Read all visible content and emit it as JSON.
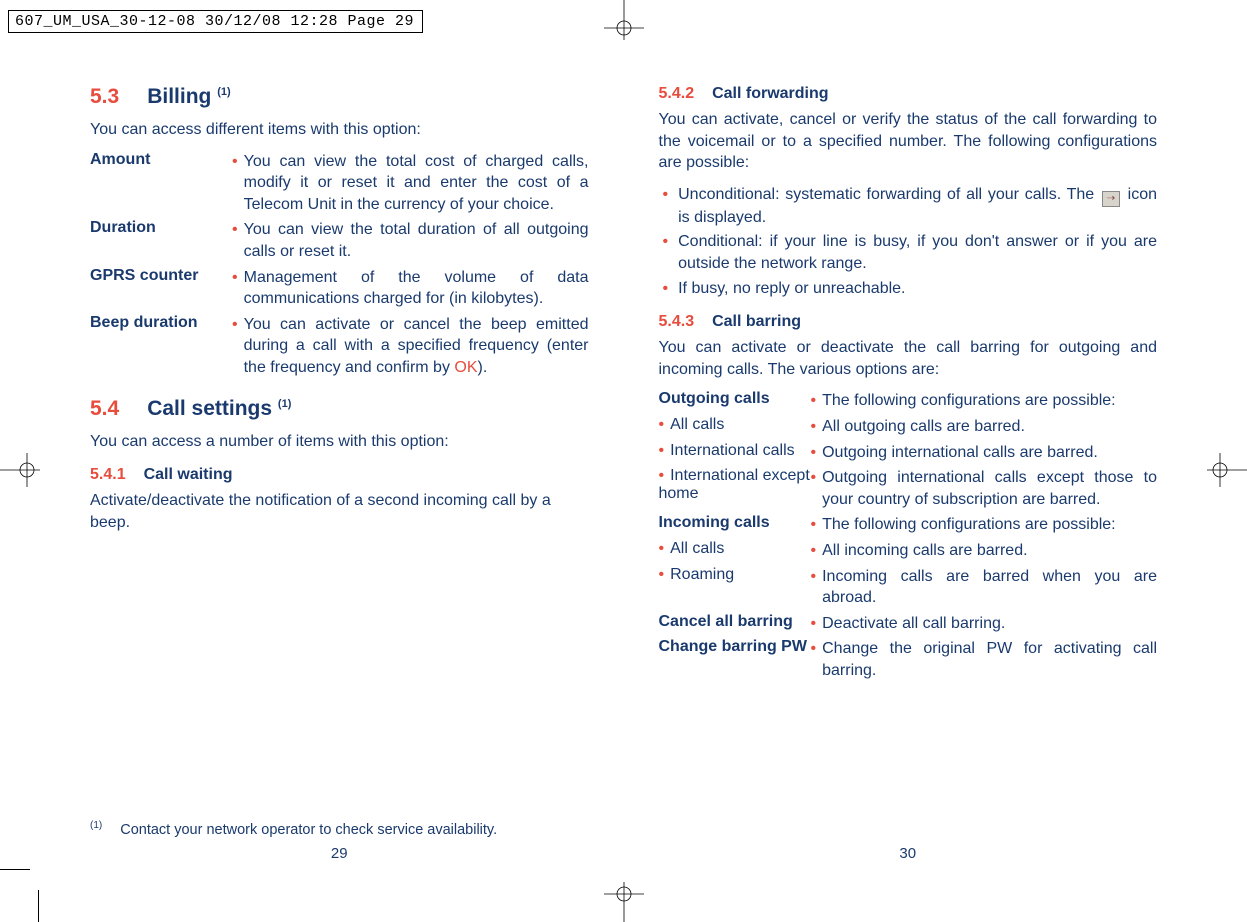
{
  "header_strip": "607_UM_USA_30-12-08  30/12/08  12:28  Page 29",
  "left": {
    "page_num": "29",
    "s53": {
      "num": "5.3",
      "title": "Billing",
      "sup": "(1)",
      "intro": "You can access different items with this option:",
      "rows": [
        {
          "label": "Amount",
          "text": "You can view the total cost of charged calls, modify it or reset it and enter the cost of a Telecom Unit in the currency of your choice."
        },
        {
          "label": "Duration",
          "text": "You can view the total duration of all outgoing calls or reset it."
        },
        {
          "label": "GPRS counter",
          "text": "Management of the volume of data communications charged for (in kilobytes)."
        },
        {
          "label": "Beep duration",
          "text_pre": "You can activate or cancel the beep emitted during a call with a specified frequency (enter the frequency and confirm by ",
          "ok": "OK",
          "text_post": ")."
        }
      ]
    },
    "s54": {
      "num": "5.4",
      "title": "Call settings",
      "sup": "(1)",
      "intro": "You can access a number of items with this option:"
    },
    "s541": {
      "num": "5.4.1",
      "title": "Call waiting",
      "text": "Activate/deactivate the notification of a second incoming call by a beep."
    },
    "footnote": {
      "sup": "(1)",
      "text": "Contact your network operator to check service availability."
    }
  },
  "right": {
    "page_num": "30",
    "s542": {
      "num": "5.4.2",
      "title": "Call forwarding",
      "intro": "You can activate, cancel or verify the status of the call forwarding to the voicemail or to a specified number. The following configurations are possible:",
      "bullets": [
        {
          "pre": "Unconditional: systematic forwarding of all your calls. The ",
          "post": " icon is displayed.",
          "has_icon": true
        },
        {
          "pre": "Conditional: if your line is busy, if you don't answer or if you are outside the network range.",
          "post": "",
          "has_icon": false
        },
        {
          "pre": "If busy, no reply or unreachable.",
          "post": "",
          "has_icon": false
        }
      ]
    },
    "s543": {
      "num": "5.4.3",
      "title": "Call barring",
      "intro": "You can activate or deactivate the call barring for outgoing and incoming calls. The various options are:",
      "rows": [
        {
          "label": "Outgoing calls",
          "bold": true,
          "sub": false,
          "text": "The following configurations are possible:"
        },
        {
          "label": "All calls",
          "bold": false,
          "sub": true,
          "text": "All outgoing calls are barred."
        },
        {
          "label": "International calls",
          "bold": false,
          "sub": true,
          "text": "Outgoing international calls are barred."
        },
        {
          "label": "International except home",
          "bold": false,
          "sub": true,
          "text": "Outgoing international calls except those to your country of subscription are barred."
        },
        {
          "label": "Incoming calls",
          "bold": true,
          "sub": false,
          "text": "The following configurations are possible:"
        },
        {
          "label": "All calls",
          "bold": false,
          "sub": true,
          "text": "All incoming calls are barred."
        },
        {
          "label": "Roaming",
          "bold": false,
          "sub": true,
          "text": "Incoming calls are barred when you are abroad."
        },
        {
          "label": "Cancel all barring",
          "bold": true,
          "sub": false,
          "text": "Deactivate all call barring."
        },
        {
          "label": "Change barring PW",
          "bold": true,
          "sub": false,
          "text": "Change the original PW for activating call barring."
        }
      ]
    }
  }
}
